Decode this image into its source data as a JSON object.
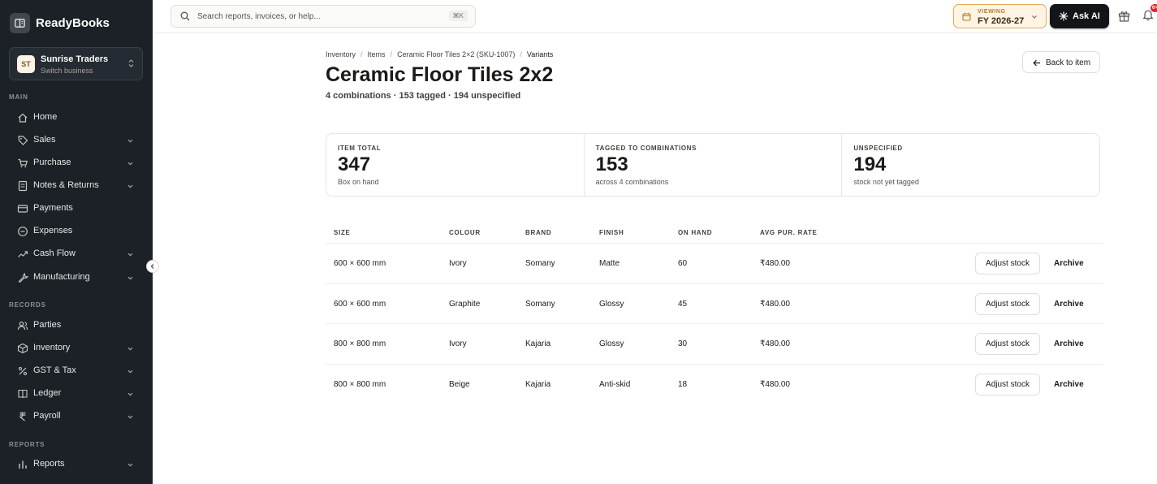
{
  "app": {
    "name": "ReadyBooks"
  },
  "business": {
    "initials": "ST",
    "name": "Sunrise Traders",
    "action": "Switch business"
  },
  "nav": {
    "sections": {
      "main": "MAIN",
      "records": "RECORDS",
      "reports": "REPORTS"
    },
    "items": [
      {
        "label": "Home",
        "icon": "home-icon",
        "has_children": false
      },
      {
        "label": "Sales",
        "icon": "tag-icon",
        "has_children": true
      },
      {
        "label": "Purchase",
        "icon": "cart-icon",
        "has_children": true
      },
      {
        "label": "Notes & Returns",
        "icon": "note-icon",
        "has_children": true
      },
      {
        "label": "Payments",
        "icon": "card-icon",
        "has_children": false
      },
      {
        "label": "Expenses",
        "icon": "minus-circle-icon",
        "has_children": false
      },
      {
        "label": "Cash Flow",
        "icon": "trend-icon",
        "has_children": true
      },
      {
        "label": "Manufacturing",
        "icon": "wrench-icon",
        "has_children": true
      },
      {
        "label": "Parties",
        "icon": "users-icon",
        "has_children": false
      },
      {
        "label": "Inventory",
        "icon": "box-icon",
        "has_children": true
      },
      {
        "label": "GST & Tax",
        "icon": "percent-icon",
        "has_children": true
      },
      {
        "label": "Ledger",
        "icon": "book-icon",
        "has_children": true
      },
      {
        "label": "Payroll",
        "icon": "rupee-icon",
        "has_children": true
      },
      {
        "label": "Reports",
        "icon": "bar-chart-icon",
        "has_children": true
      }
    ]
  },
  "topbar": {
    "search_placeholder": "Search reports, invoices, or help...",
    "shortcut": "⌘K",
    "fy_label": "VIEWING",
    "fy_value": "FY 2026-27",
    "ask_ai": "Ask AI",
    "notification_count": "6+"
  },
  "breadcrumb": [
    "Inventory",
    "Items",
    "Ceramic Floor Tiles 2×2 (SKU-1007)",
    "Variants"
  ],
  "page": {
    "title": "Ceramic Floor Tiles 2x2",
    "subtitle": "4 combinations · 153 tagged · 194 unspecified",
    "back_label": "Back to item"
  },
  "stats": [
    {
      "label": "ITEM TOTAL",
      "value": "347",
      "note": "Box on hand"
    },
    {
      "label": "TAGGED TO COMBINATIONS",
      "value": "153",
      "note": "across 4 combinations"
    },
    {
      "label": "UNSPECIFIED",
      "value": "194",
      "note": "stock not yet tagged"
    }
  ],
  "table": {
    "columns": [
      "SIZE",
      "COLOUR",
      "BRAND",
      "FINISH",
      "ON HAND",
      "AVG PUR. RATE"
    ],
    "rows": [
      {
        "size": "600 × 600 mm",
        "colour": "Ivory",
        "brand": "Somany",
        "finish": "Matte",
        "on_hand": "60",
        "rate": "₹480.00"
      },
      {
        "size": "600 × 600 mm",
        "colour": "Graphite",
        "brand": "Somany",
        "finish": "Glossy",
        "on_hand": "45",
        "rate": "₹480.00"
      },
      {
        "size": "800 × 800 mm",
        "colour": "Ivory",
        "brand": "Kajaria",
        "finish": "Glossy",
        "on_hand": "30",
        "rate": "₹480.00"
      },
      {
        "size": "800 × 800 mm",
        "colour": "Beige",
        "brand": "Kajaria",
        "finish": "Anti-skid",
        "on_hand": "18",
        "rate": "₹480.00"
      }
    ],
    "adjust_label": "Adjust stock",
    "archive_label": "Archive"
  }
}
